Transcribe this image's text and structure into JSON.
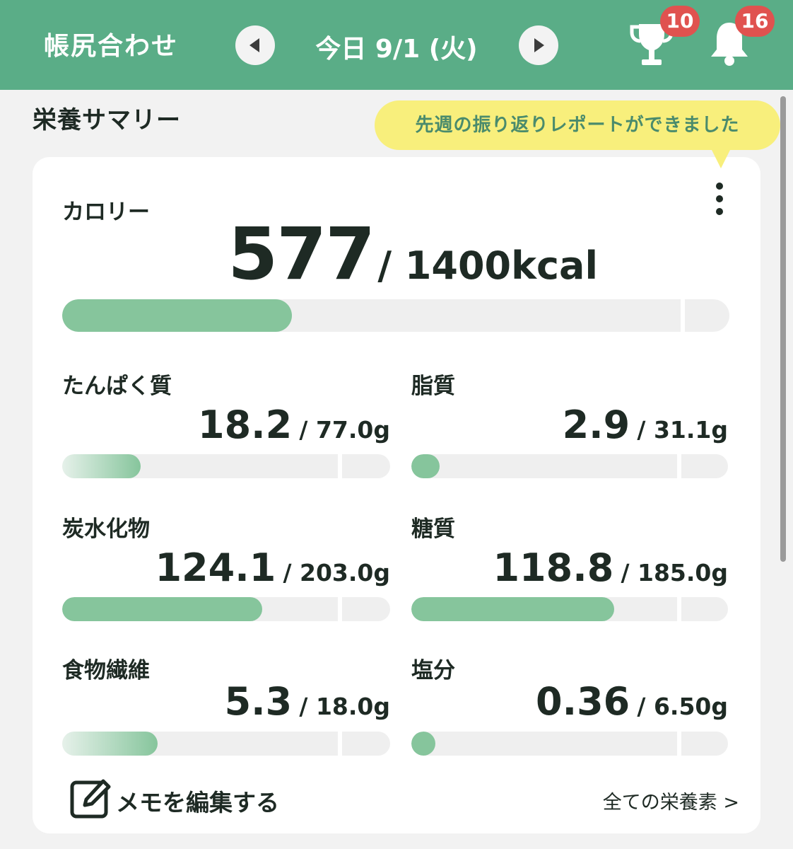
{
  "header": {
    "title": "帳尻合わせ",
    "date": "今日 9/1 (火)",
    "trophy_badge": "10",
    "bell_badge": "16",
    "bg_color": "#5aad87"
  },
  "section": {
    "title": "栄養サマリー",
    "tooltip": "先週の振り返りレポートができました"
  },
  "calorie": {
    "label": "カロリー",
    "value": "577",
    "target": "/ 1400kcal",
    "progress": 0.41
  },
  "nutrients": [
    {
      "label": "たんぱく質",
      "value": "18.2",
      "target": "/ 77.0g",
      "progress": 0.24,
      "style": "gradient"
    },
    {
      "label": "脂質",
      "value": "2.9",
      "target": "/ 31.1g",
      "progress": 0.09,
      "style": "solid"
    },
    {
      "label": "炭水化物",
      "value": "124.1",
      "target": "/ 203.0g",
      "progress": 0.61,
      "style": "solid"
    },
    {
      "label": "糖質",
      "value": "118.8",
      "target": "/ 185.0g",
      "progress": 0.64,
      "style": "solid"
    },
    {
      "label": "食物繊維",
      "value": "5.3",
      "target": "/ 18.0g",
      "progress": 0.29,
      "style": "gradient"
    },
    {
      "label": "塩分",
      "value": "0.36",
      "target": "/ 6.50g",
      "progress": 0.06,
      "style": "solid"
    }
  ],
  "footer": {
    "memo_label": "メモを編集する",
    "all_nutrients_label": "全ての栄養素 >"
  },
  "colors": {
    "accent": "#5aad87",
    "bar_fill": "#86c59c",
    "bar_track": "#efefef",
    "badge": "#e0524f",
    "tooltip_bg": "#f8ef7c"
  },
  "icons": [
    "chevron-left-icon",
    "chevron-right-icon",
    "trophy-icon",
    "bell-icon",
    "more-vertical-icon",
    "edit-note-icon"
  ]
}
